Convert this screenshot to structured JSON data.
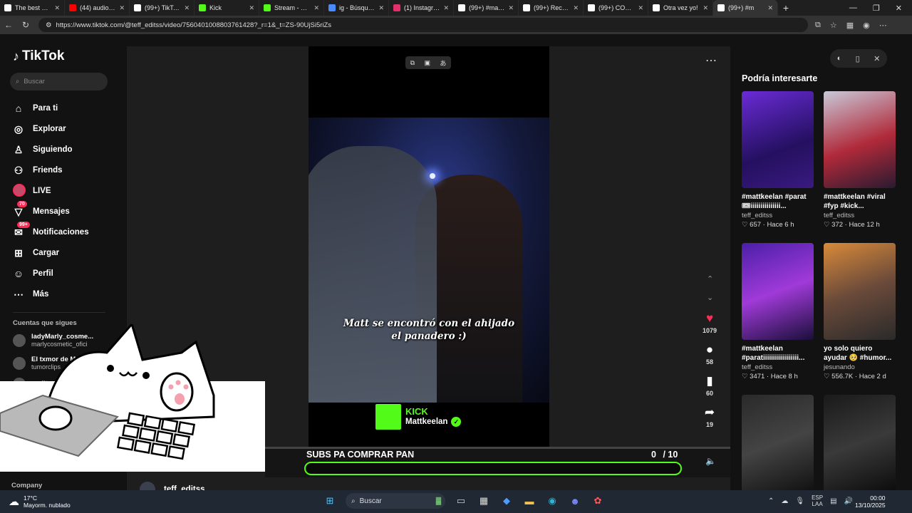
{
  "browser": {
    "tabs": [
      {
        "title": "The best Chat",
        "color": "#ffffff",
        "icon": "chat-icon"
      },
      {
        "title": "(44) audio FU",
        "color": "#ff0000",
        "icon": "youtube-icon"
      },
      {
        "title": "(99+) TikTok -",
        "color": "#ffffff",
        "icon": "tiktok-icon"
      },
      {
        "title": "Kick",
        "color": "#53fc18",
        "icon": "kick-icon"
      },
      {
        "title": "Stream - Kick",
        "color": "#53fc18",
        "icon": "kick-icon"
      },
      {
        "title": "ig - Búsqueda",
        "color": "#4a8cff",
        "icon": "search-icon"
      },
      {
        "title": "(1) Instagram",
        "color": "#e1306c",
        "icon": "instagram-icon"
      },
      {
        "title": "(99+) #mattke",
        "color": "#ffffff",
        "icon": "tiktok-icon"
      },
      {
        "title": "(99+) Recuerd",
        "color": "#ffffff",
        "icon": "tiktok-icon"
      },
      {
        "title": "(99+) CORAZÓ",
        "color": "#ffffff",
        "icon": "tiktok-icon"
      },
      {
        "title": "Otra vez yo!",
        "color": "#ffffff",
        "icon": "tiktok-icon"
      },
      {
        "title": "(99+) #m",
        "color": "#ffffff",
        "icon": "tiktok-icon"
      }
    ],
    "url": "https://www.tiktok.com/@teff_editss/video/7560401008803761428?_r=1&_t=ZS-90UjSi5riZs"
  },
  "tiktok": {
    "logo": "TikTok",
    "search_placeholder": "Buscar",
    "nav": [
      {
        "label": "Para ti",
        "icon": "home-icon",
        "glyph": "⌂"
      },
      {
        "label": "Explorar",
        "icon": "compass-icon",
        "glyph": "◎"
      },
      {
        "label": "Siguiendo",
        "icon": "following-icon",
        "glyph": "♙"
      },
      {
        "label": "Friends",
        "icon": "friends-icon",
        "glyph": "⚇"
      },
      {
        "label": "LIVE",
        "icon": "live-avatar",
        "glyph": ""
      },
      {
        "label": "Mensajes",
        "icon": "messages-icon",
        "glyph": "▽",
        "badge": "70"
      },
      {
        "label": "Notificaciones",
        "icon": "notifications-icon",
        "glyph": "✉",
        "badge": "99+"
      },
      {
        "label": "Cargar",
        "icon": "upload-icon",
        "glyph": "⊞"
      },
      {
        "label": "Perfil",
        "icon": "profile-icon",
        "glyph": "☺"
      },
      {
        "label": "Más",
        "icon": "more-icon",
        "glyph": "⋯"
      }
    ],
    "following_title": "Cuentas que sigues",
    "following": [
      {
        "name": "ladyMarly_cosme...",
        "sub": "marlycosmetic_ofici"
      },
      {
        "name": "El txmor de M",
        "sub": "tumorclips"
      },
      {
        "name": "yudit",
        "sub": ""
      }
    ],
    "company": "Company"
  },
  "video": {
    "caption": "Matt se encontró con el ahijado el panadero :)",
    "kick_label": "KICK",
    "kick_name": "Mattkeelan",
    "likes": "1079",
    "comments": "58",
    "saves": "60",
    "shares": "19",
    "author": "teff_editss"
  },
  "subs_goal": {
    "label": "SUBS PA COMPRAR PAN",
    "current": "0",
    "total": "/ 10",
    "progress": 0.0
  },
  "recommendations": {
    "title": "Podría interesarte",
    "cards": [
      {
        "title": "#mattkeelan #parat🎟iiiiiiiiiiiiiii...",
        "user": "teff_editss",
        "meta": "♡ 657 · Hace 6 h",
        "bg": "linear-gradient(160deg,#6a2bd6,#241060 60%,#3a1a80)"
      },
      {
        "title": "#mattkeelan #viral #fyp #kick...",
        "user": "teff_editss",
        "meta": "♡ 372 · Hace 12 h",
        "bg": "linear-gradient(160deg,#c9c9d9,#b02a3a 55%,#2a1a30)"
      },
      {
        "title": "#mattkeelan #paratiiiiiiiiiiiiiiiiii...",
        "user": "teff_editss",
        "meta": "♡ 3471 · Hace 8 h",
        "bg": "linear-gradient(160deg,#4b1fa8,#a03ad8 50%,#1a0f3a)"
      },
      {
        "title": "yo solo quiero ayudar 🥺 #humor...",
        "user": "jesunando",
        "meta": "♡ 556.7K · Hace 2 d",
        "bg": "linear-gradient(160deg,#d88a3a,#6a4a3a 50%,#2a2a2a)"
      },
      {
        "title": "",
        "user": "",
        "meta": "",
        "bg": "linear-gradient(160deg,#2a2a2a,#444 50%,#111)"
      },
      {
        "title": "",
        "user": "",
        "meta": "",
        "bg": "linear-gradient(160deg,#1a1a1a,#3a3a3a 50%,#0c0c0c)"
      }
    ]
  },
  "taskbar": {
    "temp": "17°C",
    "weather": "Mayorm. nublado",
    "search": "Buscar",
    "lang": "ESP",
    "lang_sub": "LAA",
    "time": "00:00",
    "date": "13/10/2025"
  }
}
